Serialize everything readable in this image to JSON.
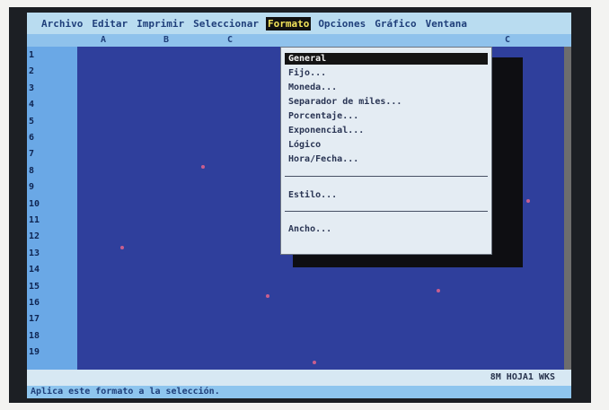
{
  "menubar": {
    "items": [
      "Archivo",
      "Editar",
      "Imprimir",
      "Seleccionar",
      "Formato",
      "Opciones",
      "Gráfico",
      "Ventana"
    ],
    "active_index": 4
  },
  "columns": [
    "A",
    "B",
    "C",
    "C"
  ],
  "rows": [
    "1",
    "2",
    "3",
    "4",
    "5",
    "6",
    "7",
    "8",
    "9",
    "10",
    "11",
    "12",
    "13",
    "14",
    "15",
    "16",
    "17",
    "18",
    "19"
  ],
  "dropdown": {
    "items": [
      "General",
      "Fijo...",
      "Moneda...",
      "Separador de miles...",
      "Porcentaje...",
      "Exponencial...",
      "Lógico",
      "Hora/Fecha...",
      "Estilo...",
      "Ancho..."
    ],
    "active_index": 0
  },
  "status": {
    "right_text": "8M HOJA1 WKS"
  },
  "message": {
    "text": "Aplica este formato a la selección."
  }
}
